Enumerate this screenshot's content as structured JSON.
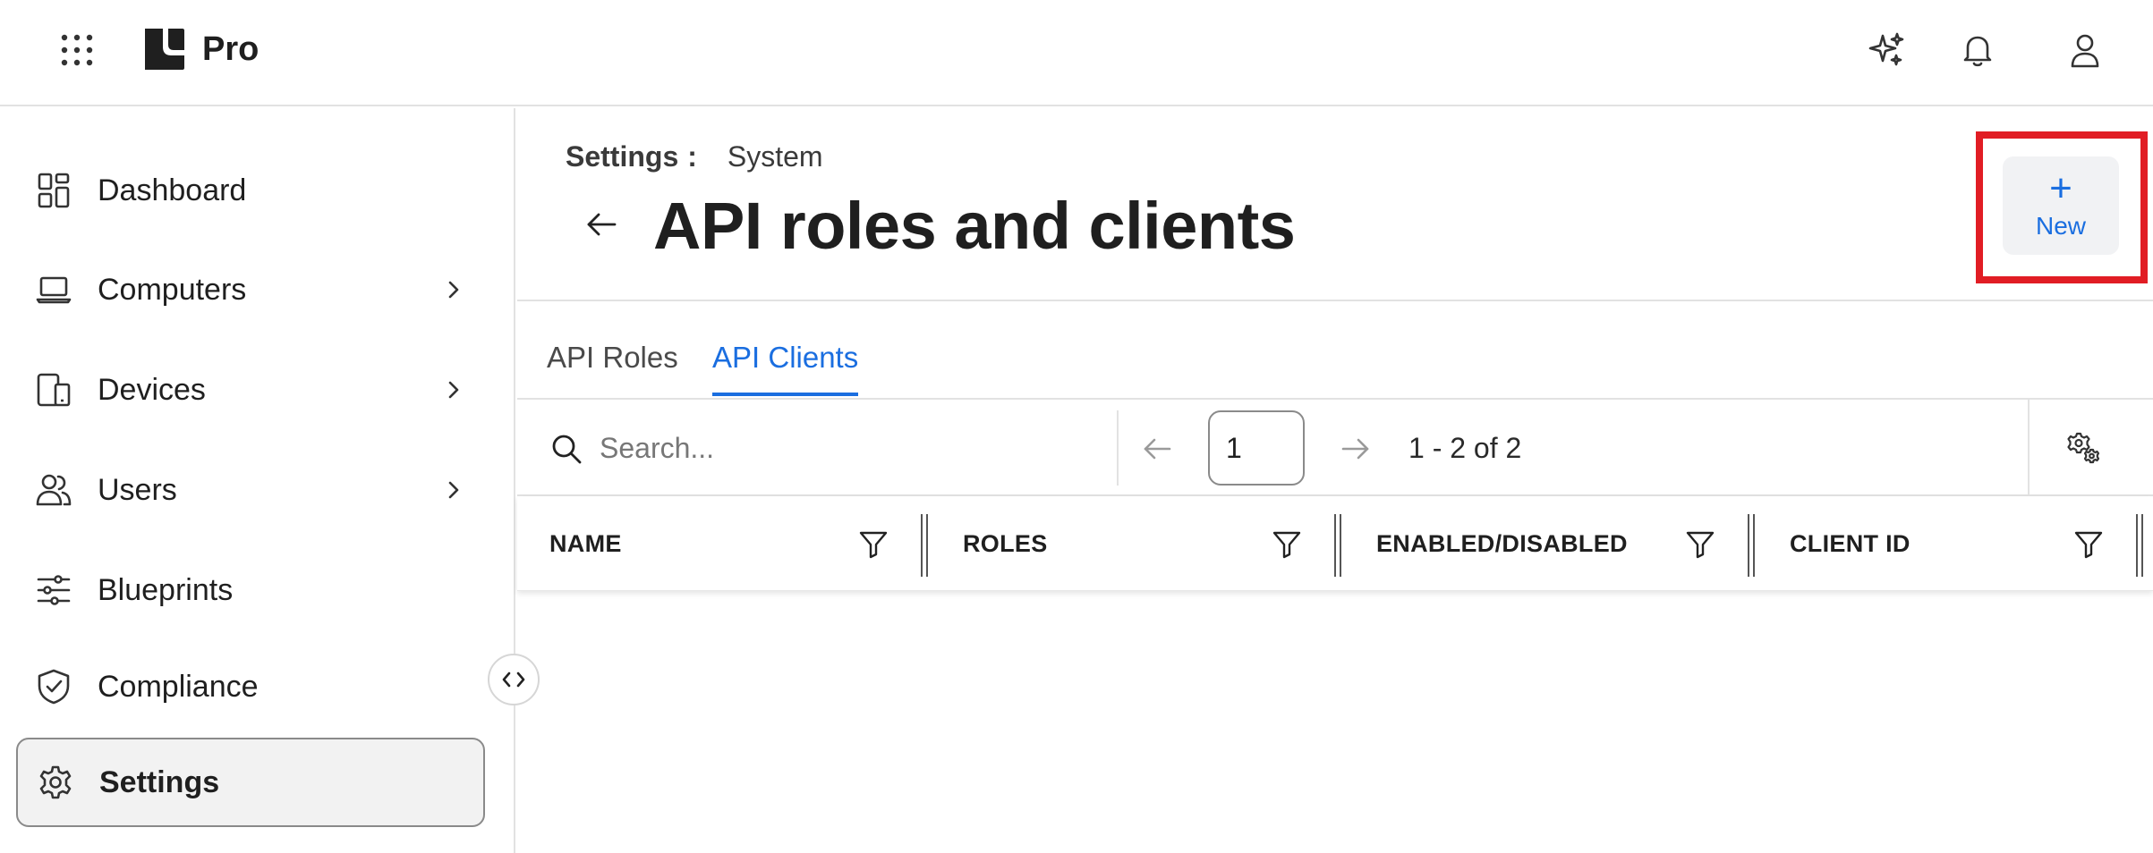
{
  "app": {
    "brand": "Pro"
  },
  "sidebar": {
    "items": [
      {
        "label": "Dashboard"
      },
      {
        "label": "Computers"
      },
      {
        "label": "Devices"
      },
      {
        "label": "Users"
      },
      {
        "label": "Blueprints"
      },
      {
        "label": "Compliance"
      },
      {
        "label": "Settings"
      }
    ],
    "active": "Settings"
  },
  "header": {
    "breadcrumb_root": "Settings",
    "breadcrumb_sep": ":",
    "breadcrumb_leaf": "System",
    "title": "API roles and clients",
    "new_label": "New",
    "new_plus": "+"
  },
  "tabs": [
    {
      "label": "API Roles",
      "active": false
    },
    {
      "label": "API Clients",
      "active": true
    }
  ],
  "toolbar": {
    "search_placeholder": "Search...",
    "page_value": "1",
    "range": "1 - 2 of 2"
  },
  "table": {
    "columns": [
      "NAME",
      "ROLES",
      "ENABLED/DISABLED",
      "CLIENT ID"
    ]
  },
  "colors": {
    "accent": "#1a6ee0",
    "highlight": "#e11d24"
  },
  "icons": {
    "collapse": "code-brackets-icon"
  }
}
